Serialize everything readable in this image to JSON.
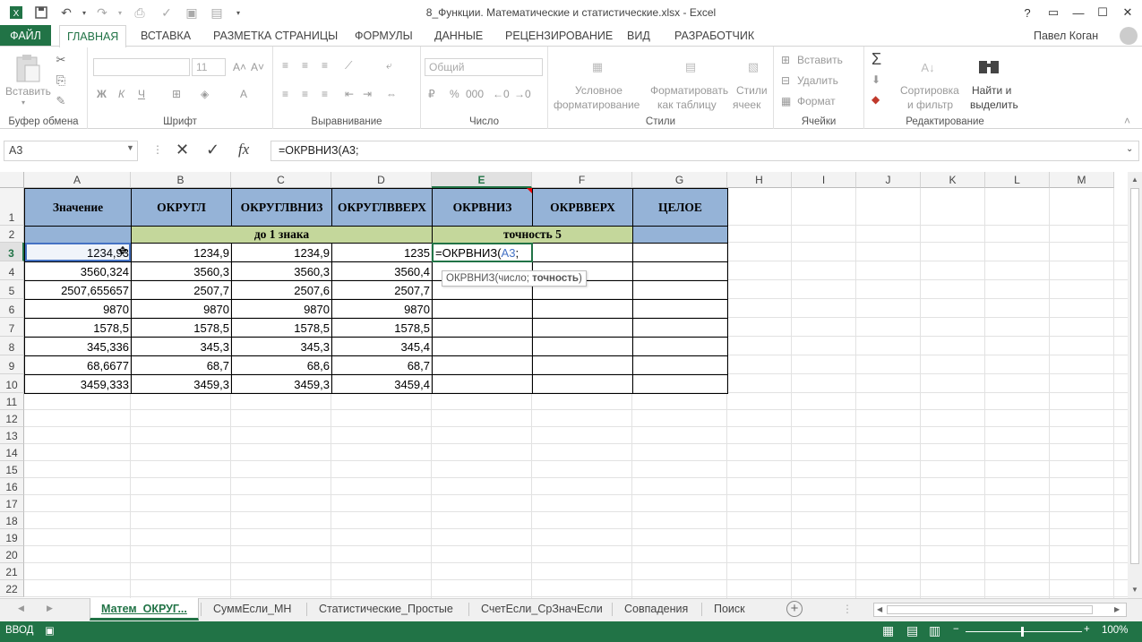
{
  "window": {
    "title": "8_Функции. Математические и статистические.xlsx - Excel",
    "help": "?",
    "user": "Павел Коган"
  },
  "ribbon": {
    "tabs": [
      "ФАЙЛ",
      "ГЛАВНАЯ",
      "ВСТАВКА",
      "РАЗМЕТКА СТРАНИЦЫ",
      "ФОРМУЛЫ",
      "ДАННЫЕ",
      "РЕЦЕНЗИРОВАНИЕ",
      "ВИД",
      "РАЗРАБОТЧИК"
    ],
    "active_tab": "ГЛАВНАЯ",
    "groups": {
      "clipboard": {
        "label": "Буфер обмена",
        "paste": "Вставить"
      },
      "font": {
        "label": "Шрифт",
        "size": "11",
        "bold": "Ж",
        "italic": "К",
        "underline": "Ч"
      },
      "alignment": {
        "label": "Выравнивание"
      },
      "number": {
        "label": "Число",
        "format": "Общий",
        "percent": "%",
        "thousands": "000"
      },
      "styles": {
        "label": "Стили",
        "cond1": "Условное",
        "cond2": "форматирование",
        "table1": "Форматировать",
        "table2": "как таблицу",
        "cell1": "Стили",
        "cell2": "ячеек"
      },
      "cells": {
        "label": "Ячейки",
        "insert": "Вставить",
        "delete": "Удалить",
        "format": "Формат"
      },
      "editing": {
        "label": "Редактирование",
        "sort1": "Сортировка",
        "sort2": "и фильтр",
        "find1": "Найти и",
        "find2": "выделить"
      }
    }
  },
  "formula_bar": {
    "name_box": "A3",
    "fx": "fx",
    "formula": "=ОКРВНИЗ(A3;"
  },
  "columns": [
    "A",
    "B",
    "C",
    "D",
    "E",
    "F",
    "G",
    "H",
    "I",
    "J",
    "K",
    "L",
    "M"
  ],
  "selected_column": "E",
  "rows": [
    "1",
    "2",
    "3",
    "4",
    "5",
    "6",
    "7",
    "8",
    "9",
    "10",
    "11",
    "12",
    "13",
    "14",
    "15",
    "16",
    "17",
    "18",
    "19",
    "20",
    "21",
    "22"
  ],
  "selected_row": "3",
  "sheet": {
    "headers": [
      "Значение",
      "ОКРУГЛ",
      "ОКРУГЛВНИЗ",
      "ОКРУГЛВВЕРХ",
      "ОКРВНИЗ",
      "ОКРВВЕРХ",
      "ЦЕЛОЕ"
    ],
    "subheader_1": "до 1 знака",
    "subheader_2": "точность 5",
    "data": [
      [
        "1234,93",
        "1234,9",
        "1234,9",
        "1235"
      ],
      [
        "3560,324",
        "3560,3",
        "3560,3",
        "3560,4"
      ],
      [
        "2507,655657",
        "2507,7",
        "2507,6",
        "2507,7"
      ],
      [
        "9870",
        "9870",
        "9870",
        "9870"
      ],
      [
        "1578,5",
        "1578,5",
        "1578,5",
        "1578,5"
      ],
      [
        "345,336",
        "345,3",
        "345,3",
        "345,4"
      ],
      [
        "68,6677",
        "68,7",
        "68,6",
        "68,7"
      ],
      [
        "3459,333",
        "3459,3",
        "3459,3",
        "3459,4"
      ]
    ],
    "edit_cell": {
      "prefix": "=ОКРВНИЗ(",
      "ref": "A3",
      "suffix": ";"
    },
    "tooltip": {
      "func": "ОКРВНИЗ(число; ",
      "arg": "точность",
      "end": ")"
    }
  },
  "sheet_tabs": [
    "Матем_ОКРУГ...",
    "СуммЕсли_МН",
    "Статистические_Простые",
    "СчетЕсли_СрЗначЕсли",
    "Совпадения",
    "Поиск"
  ],
  "active_sheet": "Матем_ОКРУГ...",
  "status": {
    "mode": "ВВОД",
    "zoom": "100%"
  }
}
